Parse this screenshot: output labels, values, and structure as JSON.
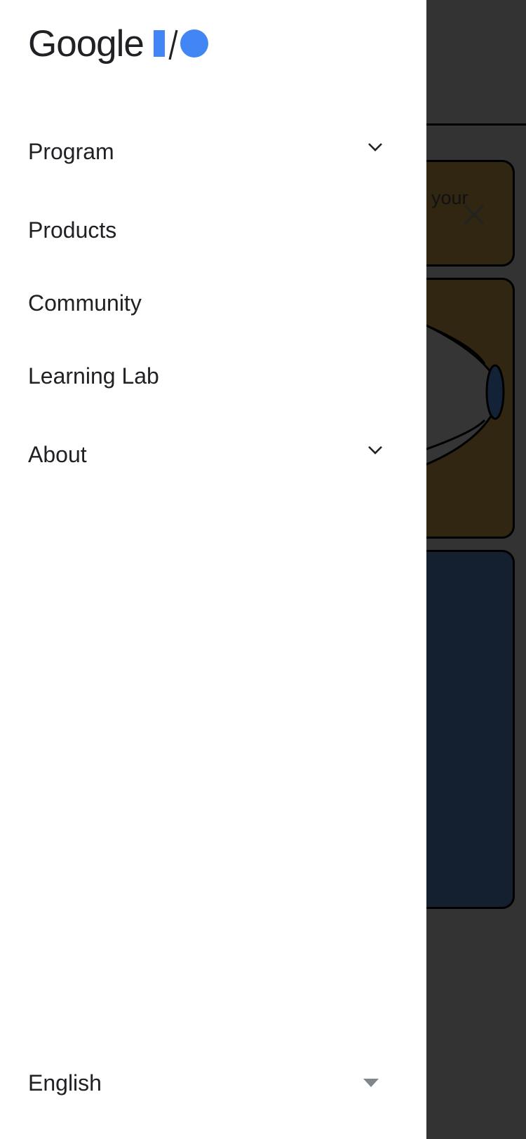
{
  "background_page": {
    "banner_text": "your",
    "close_icon": "close-icon"
  },
  "drawer": {
    "logo": {
      "wordmark": "Google",
      "mark": "I/O",
      "colors": {
        "wordmark": "#202124",
        "mark": "#4285F4"
      }
    },
    "nav_items": [
      {
        "label": "Program",
        "expandable": true,
        "icon": "chevron-down-icon"
      },
      {
        "label": "Products",
        "expandable": false
      },
      {
        "label": "Community",
        "expandable": false
      },
      {
        "label": "Learning Lab",
        "expandable": false
      },
      {
        "label": "About",
        "expandable": true,
        "icon": "chevron-down-icon"
      }
    ],
    "language": {
      "selected": "English",
      "icon": "caret-down-icon"
    }
  },
  "colors": {
    "drawer_bg": "#ffffff",
    "scrim": "#333333",
    "text": "#202124",
    "accent": "#4285F4"
  }
}
